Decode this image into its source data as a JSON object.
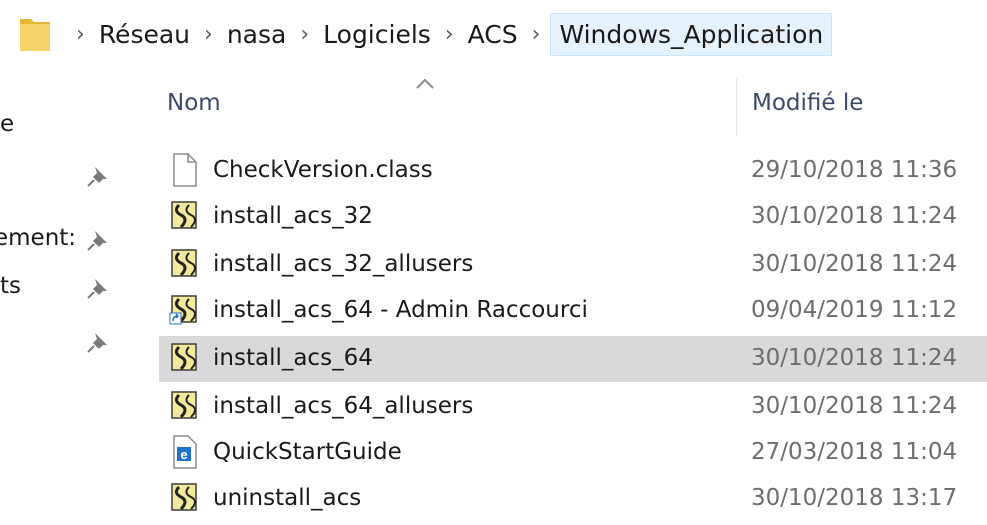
{
  "breadcrumb": {
    "items": [
      "Réseau",
      "nasa",
      "Logiciels",
      "ACS",
      "Windows_Application"
    ],
    "separator": "›"
  },
  "nav": {
    "items": [
      {
        "label": "e",
        "pinned": false
      },
      {
        "label": "",
        "pinned": true
      },
      {
        "label": "ement:",
        "pinned": true
      },
      {
        "label": "ts",
        "pinned": true
      },
      {
        "label": "",
        "pinned": true
      }
    ]
  },
  "list": {
    "sort_indicator": "chevron-up",
    "columns": {
      "name": "Nom",
      "modified": "Modifié le"
    },
    "files": [
      {
        "name": "CheckVersion.class",
        "modified": "29/10/2018 11:36",
        "icon": "blank-file-icon",
        "selected": false
      },
      {
        "name": "install_acs_32",
        "modified": "30/10/2018 11:24",
        "icon": "script-icon",
        "selected": false
      },
      {
        "name": "install_acs_32_allusers",
        "modified": "30/10/2018 11:24",
        "icon": "script-icon",
        "selected": false
      },
      {
        "name": "install_acs_64 - Admin Raccourci",
        "modified": "09/04/2019 11:12",
        "icon": "script-shortcut-icon",
        "selected": false
      },
      {
        "name": "install_acs_64",
        "modified": "30/10/2018 11:24",
        "icon": "script-icon",
        "selected": true
      },
      {
        "name": "install_acs_64_allusers",
        "modified": "30/10/2018 11:24",
        "icon": "script-icon",
        "selected": false
      },
      {
        "name": "QuickStartGuide",
        "modified": "27/03/2018 11:04",
        "icon": "html-document-icon",
        "selected": false
      },
      {
        "name": "uninstall_acs",
        "modified": "30/10/2018 13:17",
        "icon": "script-icon",
        "selected": false
      }
    ]
  },
  "colors": {
    "folder": "#f3c74a",
    "selection": "#d9d9d9",
    "active_crumb_bg": "#e5f1fb",
    "header_text": "#3a4a68",
    "date_text": "#6d6d6d"
  }
}
